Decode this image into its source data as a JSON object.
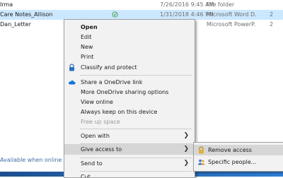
{
  "file_list": {
    "rows": [
      {
        "name": "Irma",
        "date": "7/26/2016 9:45 AM",
        "type": "File folder",
        "size": ""
      },
      {
        "name": "Care Notes_Allison",
        "date": "1/31/2018 4:46 PM",
        "type": "Microsoft Word D...",
        "size": "2"
      },
      {
        "name": "Dan_Letter",
        "date": "",
        "type": "Microsoft PowerP...",
        "size": "2"
      }
    ],
    "availability_text": "Available when online"
  },
  "context_menu": {
    "open": "Open",
    "edit": "Edit",
    "new": "New",
    "print": "Print",
    "classify": "Classify and protect",
    "share_onedrive": "Share a OneDrive link",
    "more_onedrive": "More OneDrive sharing options",
    "view_online": "View online",
    "always_keep": "Always keep on this device",
    "free_up": "Free up space",
    "open_with": "Open with",
    "give_access": "Give access to",
    "send_to": "Send to",
    "cut": "Cut"
  },
  "submenu": {
    "remove_access": "Remove access",
    "specific_people": "Specific people..."
  },
  "colors": {
    "selection": "#cce8ff",
    "menu_bg": "#f2f2f2",
    "menu_hover": "#d6d6d6",
    "onedrive_blue": "#0f78d4"
  }
}
